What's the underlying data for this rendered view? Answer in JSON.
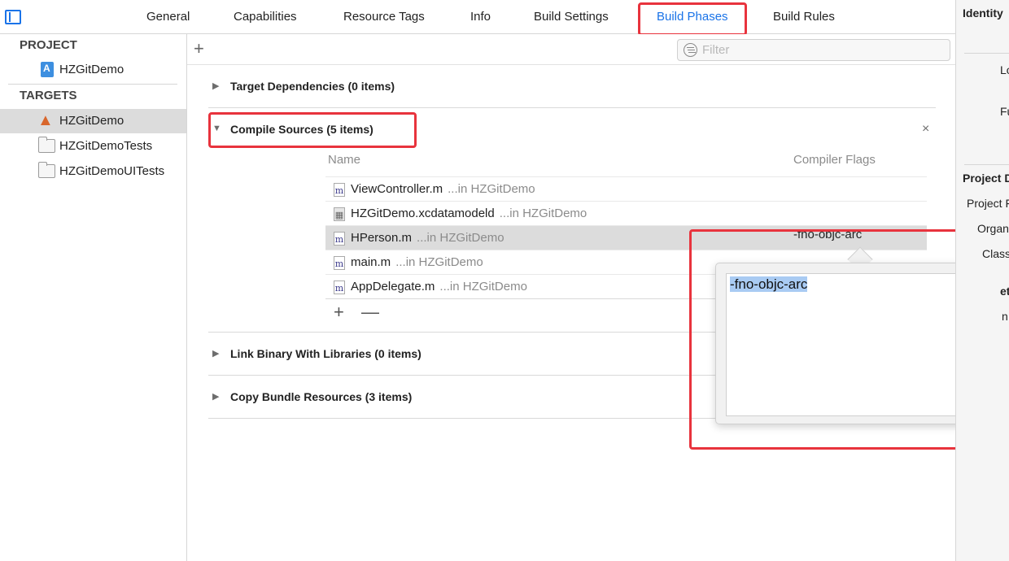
{
  "tabs": {
    "general": "General",
    "capabilities": "Capabilities",
    "resource_tags": "Resource Tags",
    "info": "Info",
    "build_settings": "Build Settings",
    "build_phases": "Build Phases",
    "build_rules": "Build Rules",
    "active": "Build Phases"
  },
  "navigator": {
    "project_header": "PROJECT",
    "project_item": "HZGitDemo",
    "targets_header": "TARGETS",
    "targets": [
      "HZGitDemo",
      "HZGitDemoTests",
      "HZGitDemoUITests"
    ],
    "selected_target": "HZGitDemo"
  },
  "toolbar": {
    "add_symbol": "+",
    "filter_placeholder": "Filter"
  },
  "phases": {
    "target_dependencies": "Target Dependencies (0 items)",
    "compile_sources": "Compile Sources (5 items)",
    "link_binary": "Link Binary With Libraries (0 items)",
    "copy_bundle": "Copy Bundle Resources (3 items)",
    "close_symbol": "×"
  },
  "compile_table": {
    "col_name": "Name",
    "col_flags": "Compiler Flags",
    "rows": [
      {
        "icon": "m",
        "name": "ViewController.m",
        "location": "...in HZGitDemo",
        "flags": ""
      },
      {
        "icon": "model",
        "name": "HZGitDemo.xcdatamodeld",
        "location": "...in HZGitDemo",
        "flags": ""
      },
      {
        "icon": "m",
        "name": "HPerson.m",
        "location": "...in HZGitDemo",
        "flags": "-fno-objc-arc"
      },
      {
        "icon": "m",
        "name": "main.m",
        "location": "...in HZGitDemo",
        "flags": ""
      },
      {
        "icon": "m",
        "name": "AppDelegate.m",
        "location": "...in HZGitDemo",
        "flags": ""
      }
    ],
    "add_symbol": "+",
    "remove_symbol": "—"
  },
  "popover": {
    "text": "-fno-objc-arc"
  },
  "inspector": {
    "identity": "Identity",
    "lo": "Lo",
    "fu": "Fu",
    "project_doc": "Project D",
    "project_f": "Project F",
    "organ": "Organ",
    "class": "Class",
    "et": "et",
    "n": "n"
  },
  "colors": {
    "accent": "#1a73e8",
    "annotation_red": "#e8333d",
    "selection_gray": "#dcdcdc",
    "text_highlight": "#a9cbf3"
  }
}
